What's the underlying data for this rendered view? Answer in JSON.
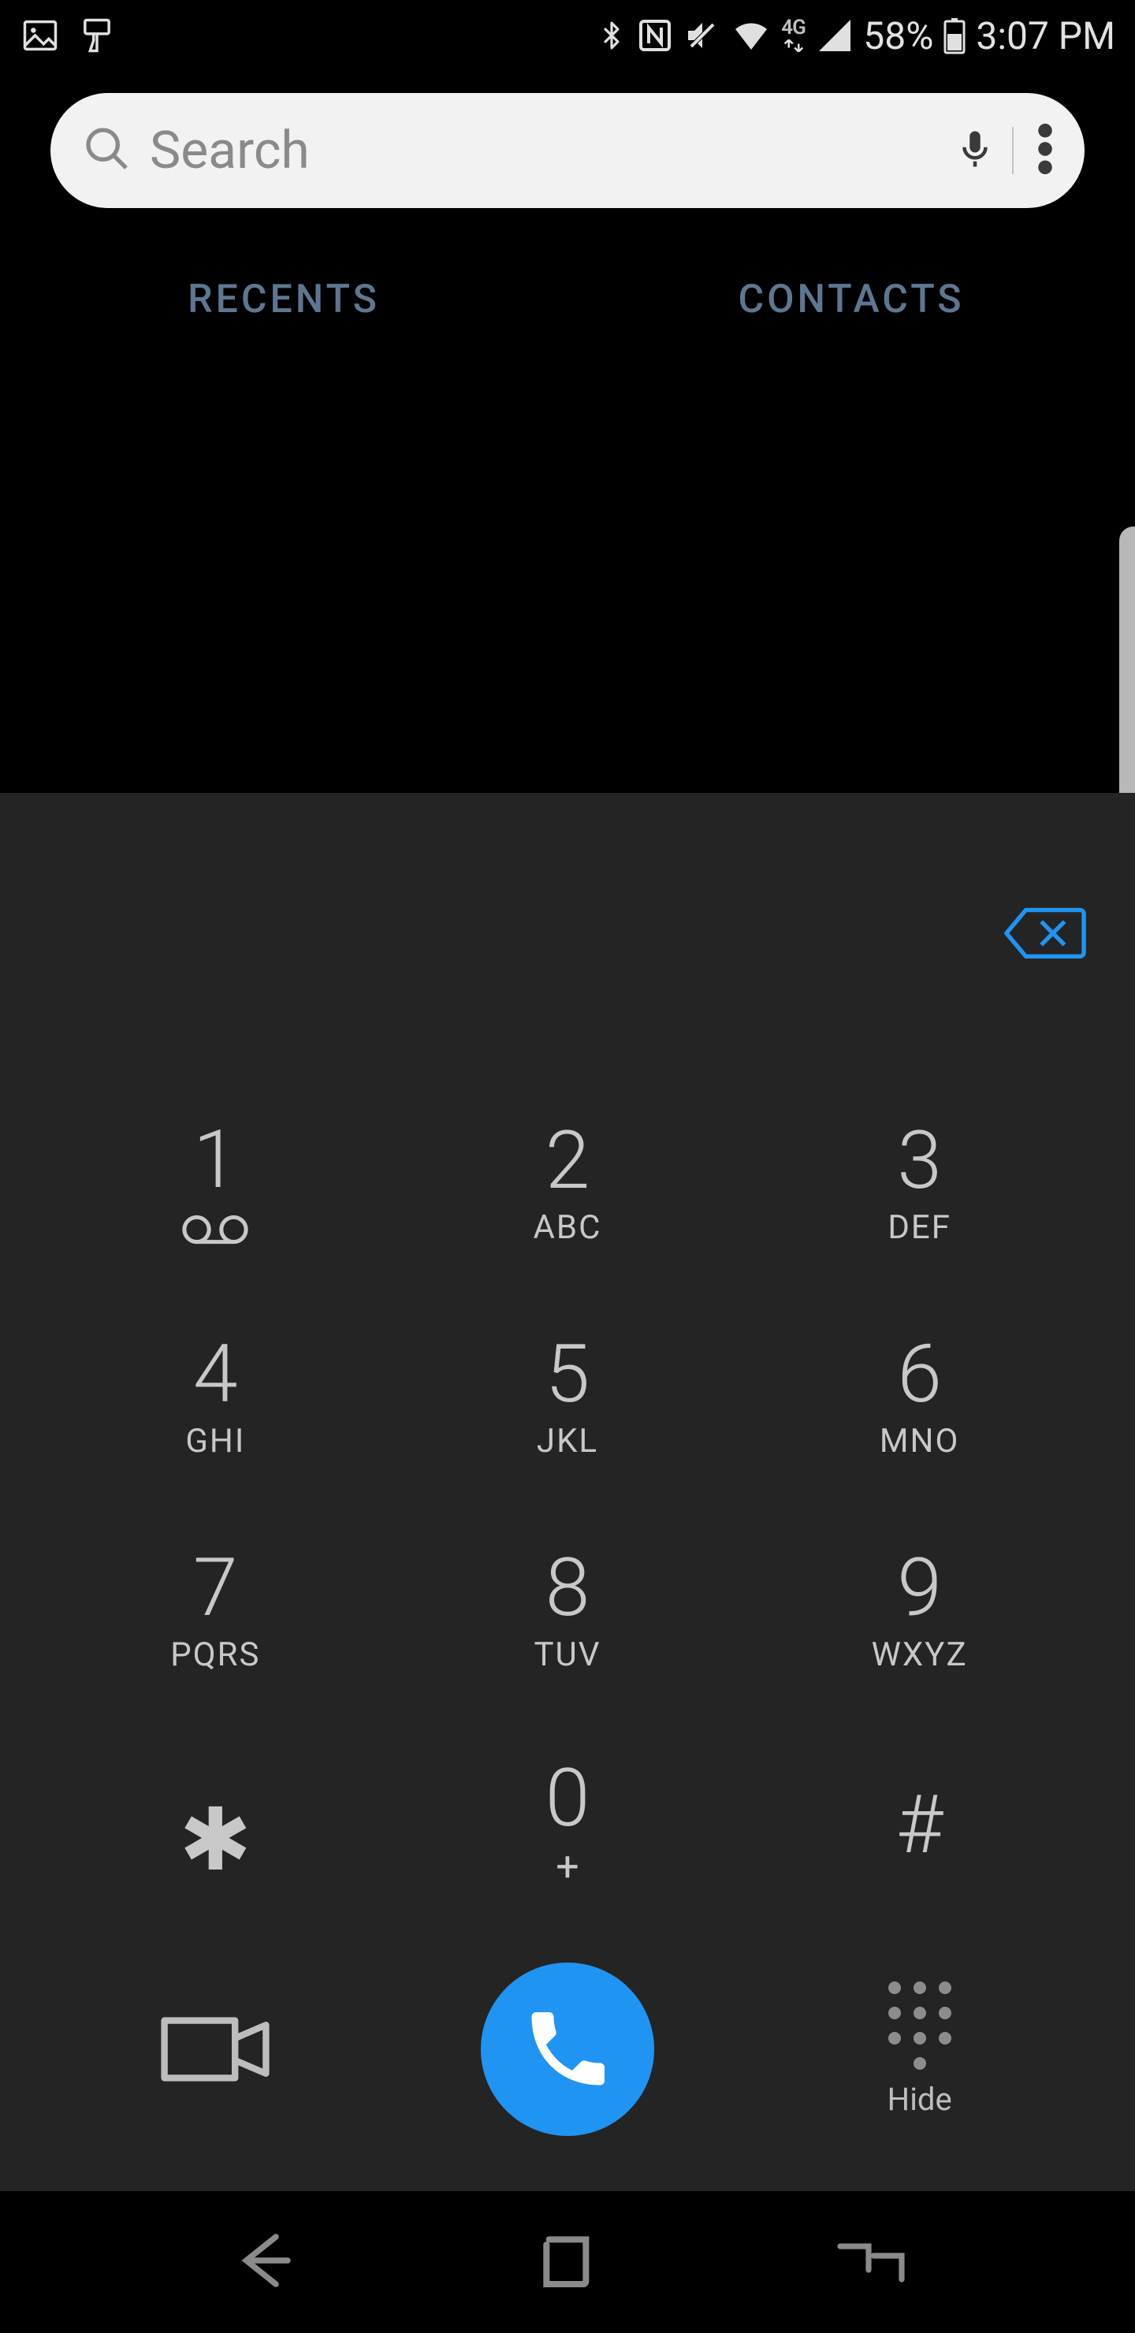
{
  "status": {
    "battery_pct": "58%",
    "time": "3:07 PM",
    "network_label": "4G"
  },
  "search": {
    "placeholder": "Search"
  },
  "tabs": {
    "recents": "RECENTS",
    "contacts": "CONTACTS"
  },
  "keypad": [
    {
      "digit": "1",
      "sub": "",
      "voicemail": true
    },
    {
      "digit": "2",
      "sub": "ABC"
    },
    {
      "digit": "3",
      "sub": "DEF"
    },
    {
      "digit": "4",
      "sub": "GHI"
    },
    {
      "digit": "5",
      "sub": "JKL"
    },
    {
      "digit": "6",
      "sub": "MNO"
    },
    {
      "digit": "7",
      "sub": "PQRS"
    },
    {
      "digit": "8",
      "sub": "TUV"
    },
    {
      "digit": "9",
      "sub": "WXYZ"
    },
    {
      "digit": "*",
      "sub": "",
      "symbol": "star"
    },
    {
      "digit": "0",
      "sub": "+"
    },
    {
      "digit": "#",
      "sub": ""
    }
  ],
  "actions": {
    "hide_label": "Hide"
  },
  "colors": {
    "accent": "#2094f3",
    "panel": "#242424"
  }
}
